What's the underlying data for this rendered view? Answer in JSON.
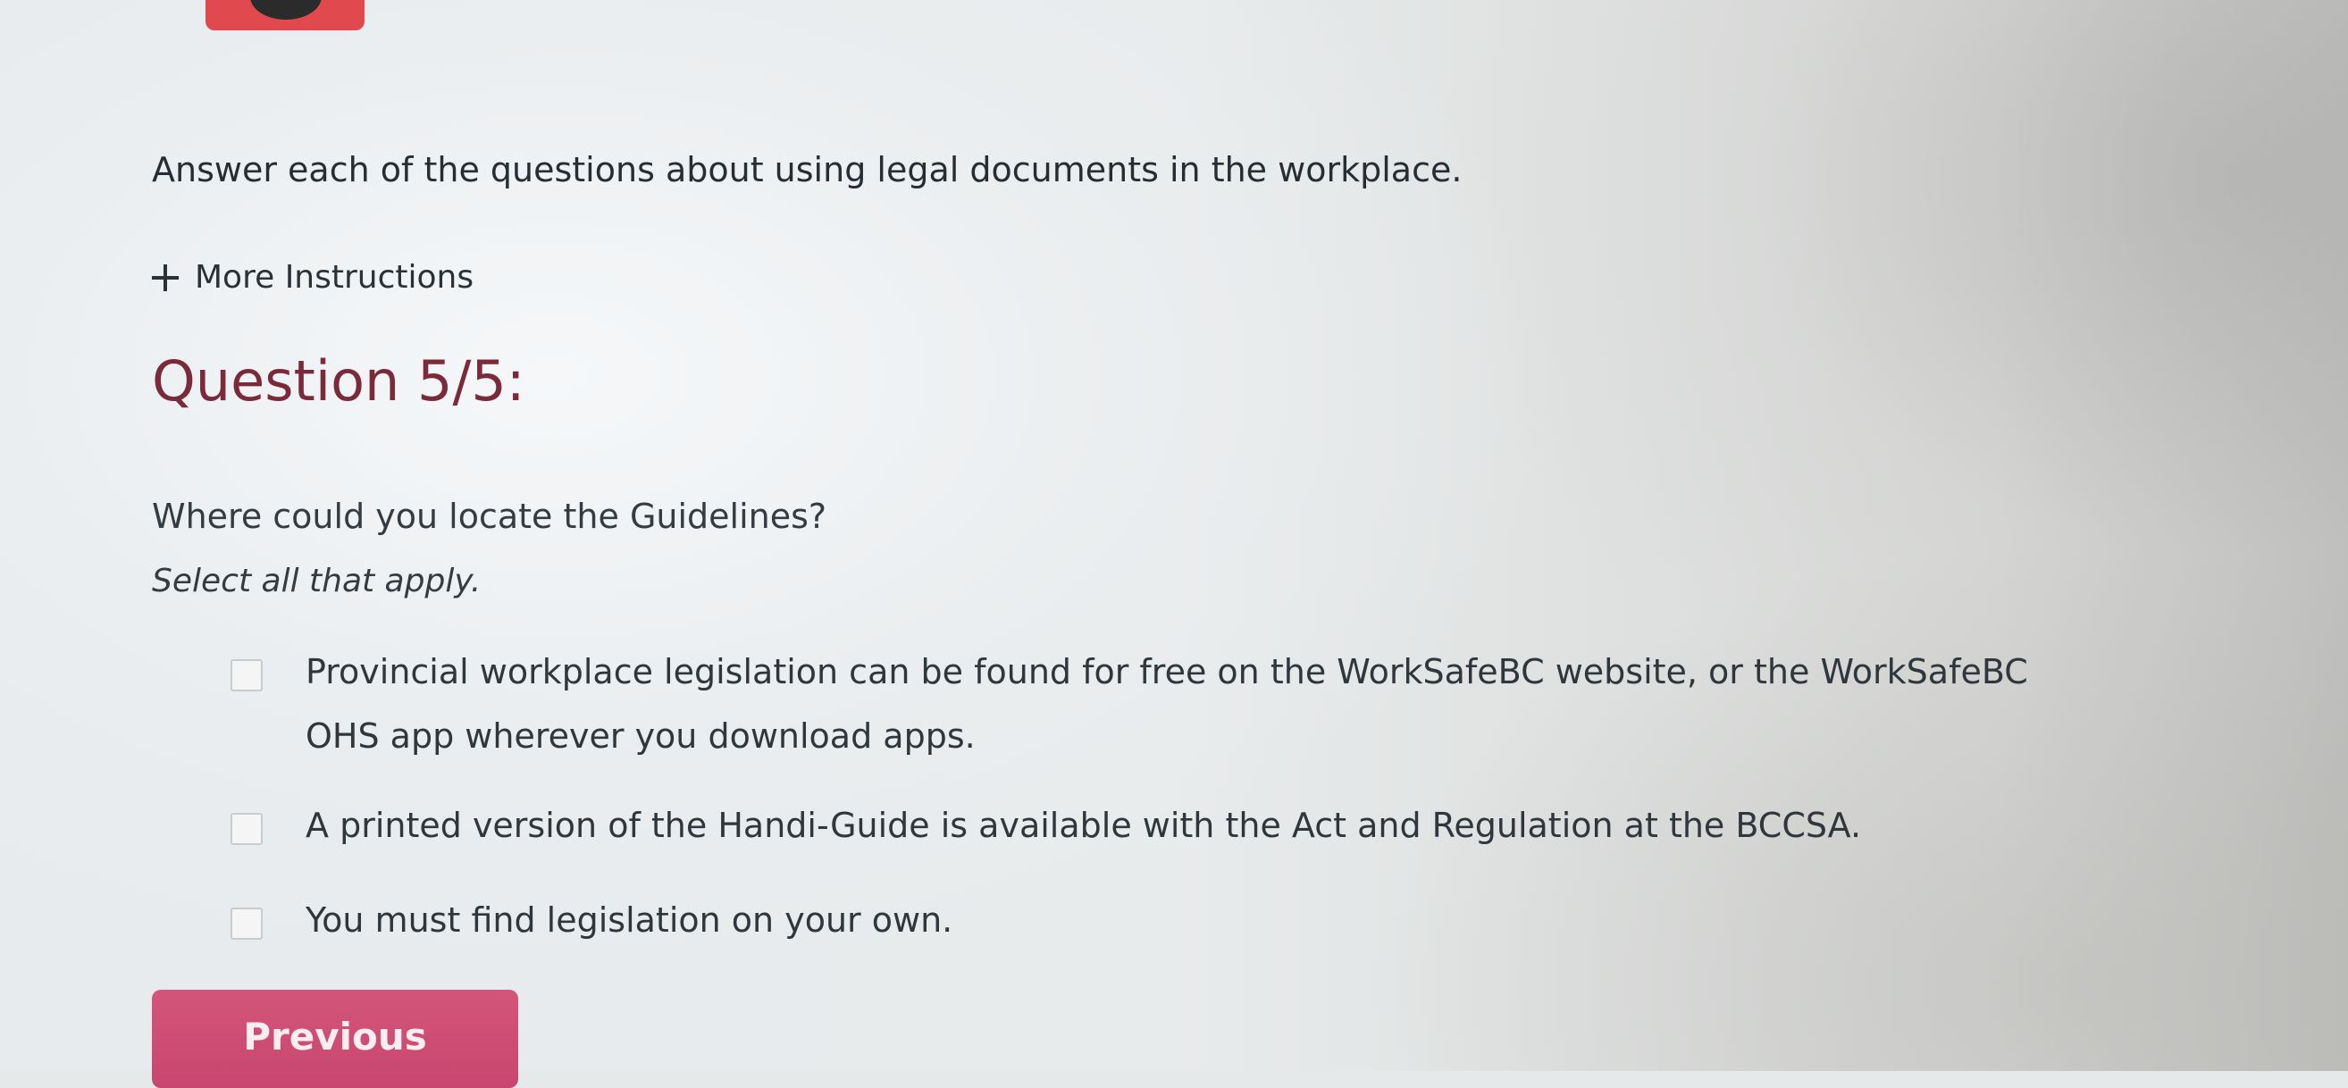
{
  "activity": {
    "instruction": "Answer each of the questions about using legal documents in the workplace.",
    "more_instructions_label": "More Instructions"
  },
  "question": {
    "title": "Question 5/5:",
    "text": "Where could you locate the Guidelines?",
    "hint": "Select all that apply.",
    "options": [
      {
        "label": "Provincial workplace legislation can be found for free on the WorkSafeBC website, or the WorkSafeBC OHS app wherever you download apps.",
        "checked": false
      },
      {
        "label": "A printed version of the Handi-Guide is available with the Act and Regulation at the BCCSA.",
        "checked": false
      },
      {
        "label": "You must find legislation on your own.",
        "checked": false
      }
    ]
  },
  "navigation": {
    "previous_label": "Previous"
  },
  "colors": {
    "accent": "#cf4f77",
    "title": "#7a2a3a",
    "top_tab": "#e04a4f"
  }
}
